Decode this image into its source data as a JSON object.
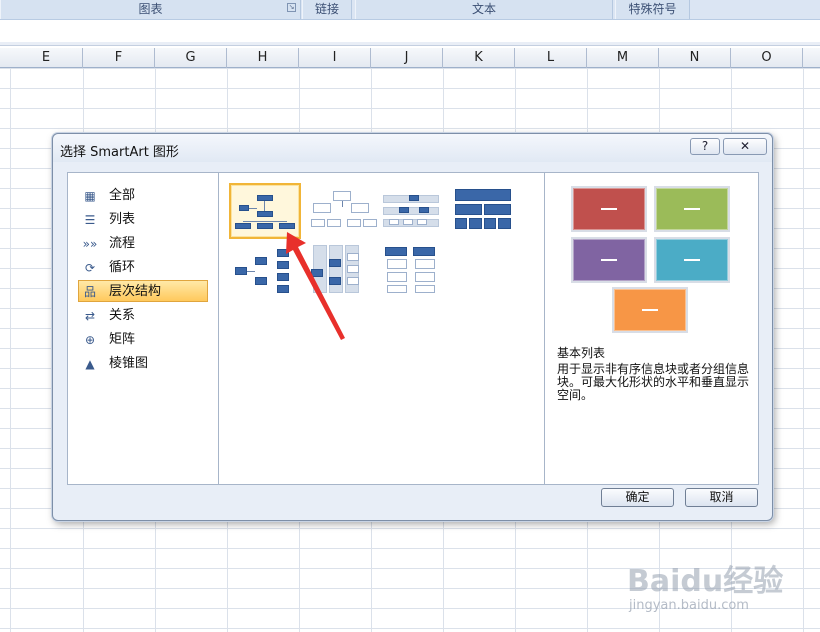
{
  "ribbon": {
    "groups": [
      {
        "label": "图表",
        "has_launcher": true
      },
      {
        "label": "链接"
      },
      {
        "label": "文本"
      },
      {
        "label": "特殊符号"
      }
    ]
  },
  "columns": [
    "E",
    "F",
    "G",
    "H",
    "I",
    "J",
    "K",
    "L",
    "M",
    "N",
    "O"
  ],
  "dialog": {
    "title": "选择 SmartArt 图形",
    "help_label": "?",
    "close_label": "✕",
    "categories": [
      {
        "label": "全部",
        "icon": "all-icon",
        "selected": false
      },
      {
        "label": "列表",
        "icon": "list-icon",
        "selected": false
      },
      {
        "label": "流程",
        "icon": "process-icon",
        "selected": false
      },
      {
        "label": "循环",
        "icon": "cycle-icon",
        "selected": false
      },
      {
        "label": "层次结构",
        "icon": "hierarchy-icon",
        "selected": true
      },
      {
        "label": "关系",
        "icon": "relationship-icon",
        "selected": false
      },
      {
        "label": "矩阵",
        "icon": "matrix-icon",
        "selected": false
      },
      {
        "label": "棱锥图",
        "icon": "pyramid-icon",
        "selected": false
      }
    ],
    "preview": {
      "title": "基本列表",
      "description": "用于显示非有序信息块或者分组信息块。可最大化形状的水平和垂直显示空间。",
      "box_colors": [
        "#c0504d",
        "#9bbb59",
        "#8064a2",
        "#4bacc6",
        "#f79646"
      ]
    },
    "ok_label": "确定",
    "cancel_label": "取消"
  },
  "watermark": {
    "main": "Baidu经验",
    "sub": "jingyan.baidu.com"
  }
}
